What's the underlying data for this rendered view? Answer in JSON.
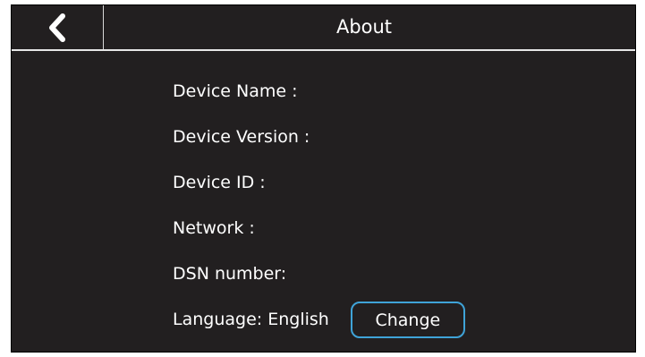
{
  "header": {
    "title": "About",
    "back_icon": "chevron-left-icon"
  },
  "info": {
    "device_name_label": "Device Name :",
    "device_version_label": "Device Version :",
    "device_id_label": "Device ID :",
    "network_label": "Network :",
    "dsn_label": "DSN number:",
    "language_label": "Language: English",
    "change_label": "Change"
  },
  "colors": {
    "background": "#221f20",
    "text": "#ffffff",
    "button_border": "#3fa3d8",
    "divider": "#e6e6e6"
  }
}
